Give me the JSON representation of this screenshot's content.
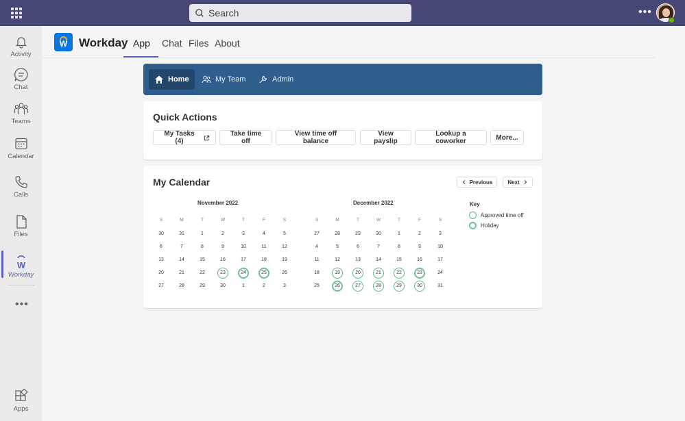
{
  "topbar": {
    "search_placeholder": "Search",
    "more_label": "•••"
  },
  "rail": {
    "items": [
      {
        "label": "Activity",
        "icon": "bell-icon"
      },
      {
        "label": "Chat",
        "icon": "chat-icon"
      },
      {
        "label": "Teams",
        "icon": "teams-icon"
      },
      {
        "label": "Calendar",
        "icon": "calendar-icon"
      },
      {
        "label": "Calls",
        "icon": "phone-icon"
      },
      {
        "label": "Files",
        "icon": "file-icon"
      },
      {
        "label": "Workday",
        "icon": "workday-icon"
      },
      {
        "label": "Apps",
        "icon": "apps-icon"
      }
    ],
    "more_label": "•••"
  },
  "app": {
    "logo_letter": "W",
    "name": "Workday",
    "tabs": [
      "App",
      "Chat",
      "Files",
      "About"
    ],
    "active_tab": "App"
  },
  "wd_nav": {
    "items": [
      "Home",
      "My Team",
      "Admin"
    ],
    "active": "Home"
  },
  "quick_actions": {
    "title": "Quick Actions",
    "buttons": [
      "My Tasks (4)",
      "Take time off",
      "View time off balance",
      "View payslip",
      "Lookup a coworker",
      "More..."
    ]
  },
  "calendar": {
    "title": "My Calendar",
    "prev_label": "Previous",
    "next_label": "Next",
    "weekdays": [
      "S",
      "M",
      "T",
      "W",
      "T",
      "F",
      "S"
    ],
    "months": [
      {
        "name": "November 2022",
        "weeks": [
          [
            "30",
            "31",
            "1",
            "2",
            "3",
            "4",
            "5"
          ],
          [
            "6",
            "7",
            "8",
            "9",
            "10",
            "11",
            "12"
          ],
          [
            "13",
            "14",
            "15",
            "16",
            "17",
            "18",
            "19"
          ],
          [
            "20",
            "21",
            "22",
            "23",
            "24",
            "25",
            "26"
          ],
          [
            "27",
            "28",
            "29",
            "30",
            "1",
            "2",
            "3"
          ]
        ],
        "approved": [
          "3-3"
        ],
        "holiday": [
          "3-4",
          "3-5"
        ]
      },
      {
        "name": "December 2022",
        "weeks": [
          [
            "27",
            "28",
            "29",
            "30",
            "1",
            "2",
            "3"
          ],
          [
            "4",
            "5",
            "6",
            "7",
            "8",
            "9",
            "10"
          ],
          [
            "11",
            "12",
            "13",
            "14",
            "15",
            "16",
            "17"
          ],
          [
            "18",
            "19",
            "20",
            "21",
            "22",
            "23",
            "24"
          ],
          [
            "25",
            "26",
            "27",
            "28",
            "29",
            "30",
            "31"
          ]
        ],
        "approved": [
          "3-1",
          "3-2",
          "3-3",
          "3-4",
          "4-2",
          "4-3",
          "4-4",
          "4-5"
        ],
        "holiday": [
          "3-5",
          "4-1"
        ]
      }
    ],
    "key": {
      "title": "Key",
      "approved_label": "Approved time off",
      "holiday_label": "Holiday"
    }
  },
  "colors": {
    "topbar": "#464775",
    "accent": "#5b5fc7",
    "workday_nav": "#2f5d8c",
    "approved_ring": "#5cb88a",
    "holiday_ring": "#6cc397"
  }
}
